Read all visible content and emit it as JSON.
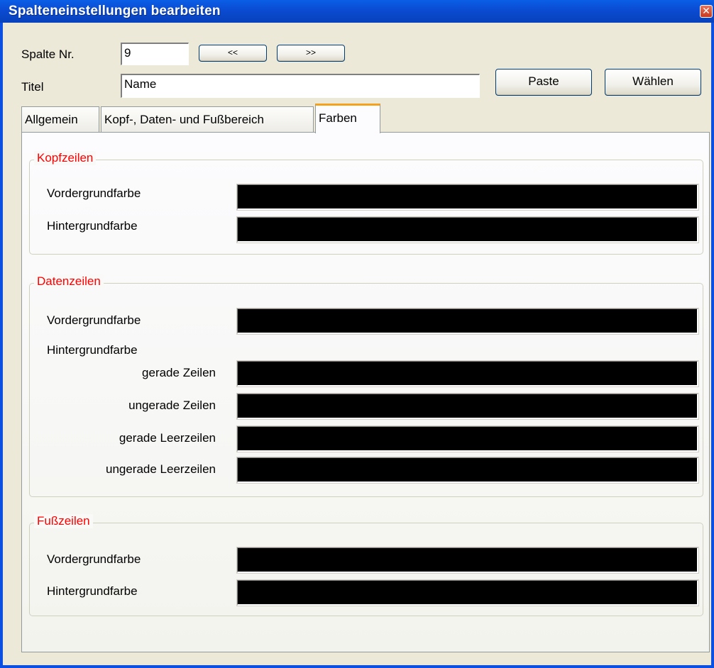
{
  "window": {
    "title": "Spalteneinstellungen bearbeiten",
    "close_glyph": "✕"
  },
  "header": {
    "spalte_label": "Spalte Nr.",
    "spalte_value": "9",
    "prev_label": "<<",
    "next_label": ">>",
    "titel_label": "Titel",
    "titel_value": "Name",
    "paste_label": "Paste",
    "waehlen_label": "Wählen"
  },
  "tabs": [
    {
      "label": "Allgemein"
    },
    {
      "label": "Kopf-, Daten- und Fußbereich"
    },
    {
      "label": "Farben",
      "active": true
    }
  ],
  "groups": {
    "kopf": {
      "title": "Kopfzeilen",
      "rows": [
        {
          "label": "Vordergrundfarbe",
          "color": "#000000"
        },
        {
          "label": "Hintergrundfarbe",
          "color": "#000000"
        }
      ]
    },
    "daten": {
      "title": "Datenzeilen",
      "vordergrund": "Vordergrundfarbe",
      "hintergrund": "Hintergrundfarbe",
      "rows": [
        {
          "label": "Vordergrundfarbe",
          "color": "#000000"
        },
        {
          "label": "gerade Zeilen",
          "color": "#000000"
        },
        {
          "label": "ungerade Zeilen",
          "color": "#000000"
        },
        {
          "label": "gerade Leerzeilen",
          "color": "#000000"
        },
        {
          "label": "ungerade Leerzeilen",
          "color": "#000000"
        }
      ]
    },
    "fuss": {
      "title": "Fußzeilen",
      "rows": [
        {
          "label": "Vordergrundfarbe",
          "color": "#000000"
        },
        {
          "label": "Hintergrundfarbe",
          "color": "#000000"
        }
      ]
    }
  },
  "colors": {
    "group_title": "#ff0000",
    "titlebar": "#0a4bd2",
    "tab_accent": "#f4a21d"
  }
}
